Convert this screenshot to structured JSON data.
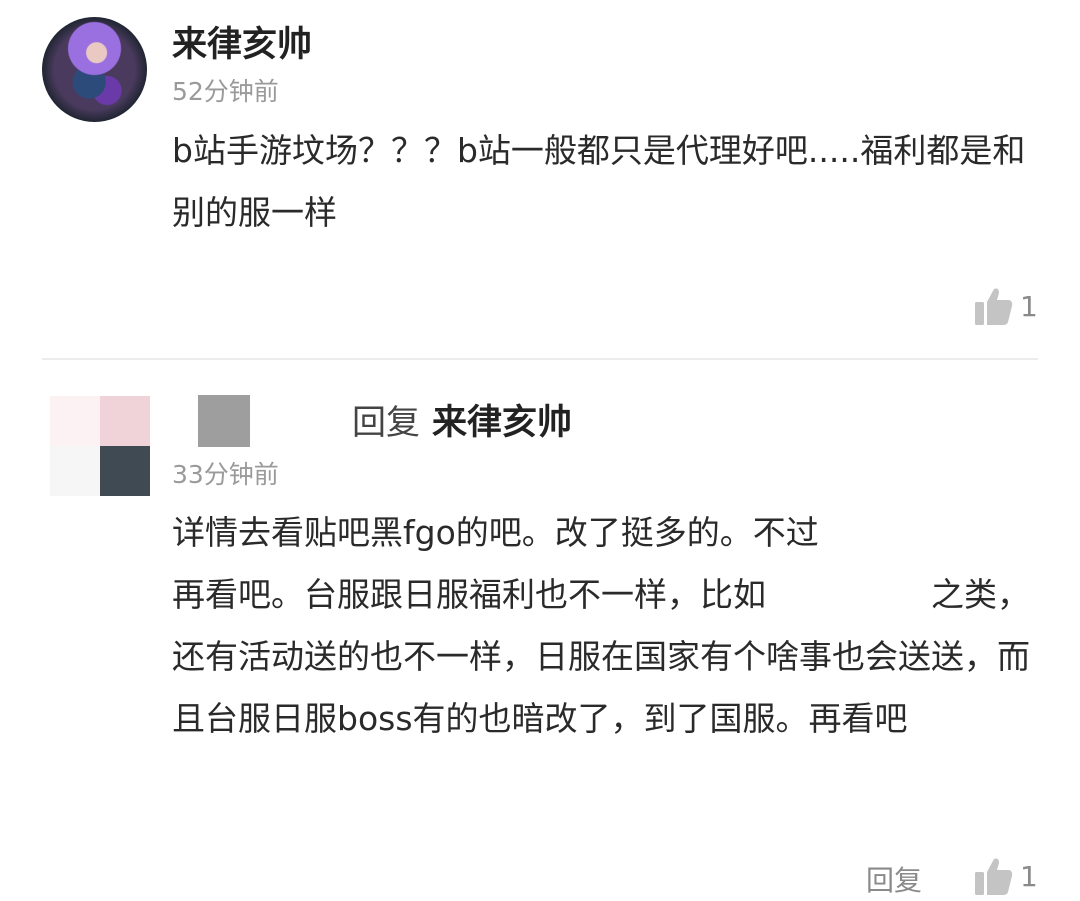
{
  "comment1": {
    "username": "来律亥帅",
    "time": "52分钟前",
    "text": "b站手游坟场？？？b站一般都只是代理好吧.....福利都是和别的服一样",
    "likes": "1",
    "like_icon": "thumbs-up-icon"
  },
  "comment2": {
    "reply_word": "回复",
    "reply_target": "来律亥帅",
    "time": "33分钟前",
    "text": "详情去看贴吧黑fgo的吧。改了挺多的。不过　　　　　　再看吧。台服跟日服福利也不一样，比如　　　　　之类，还有活动送的也不一样，日服在国家有个啥事也会送送，而且台服日服boss有的也暗改了，到了国服。再看吧",
    "reply_button": "回复",
    "likes": "1",
    "like_icon": "thumbs-up-icon"
  },
  "colors": {
    "text": "#2a2a2a",
    "secondary": "#9a9a9a",
    "divider": "#ececec",
    "icon": "#c4c4c4"
  }
}
